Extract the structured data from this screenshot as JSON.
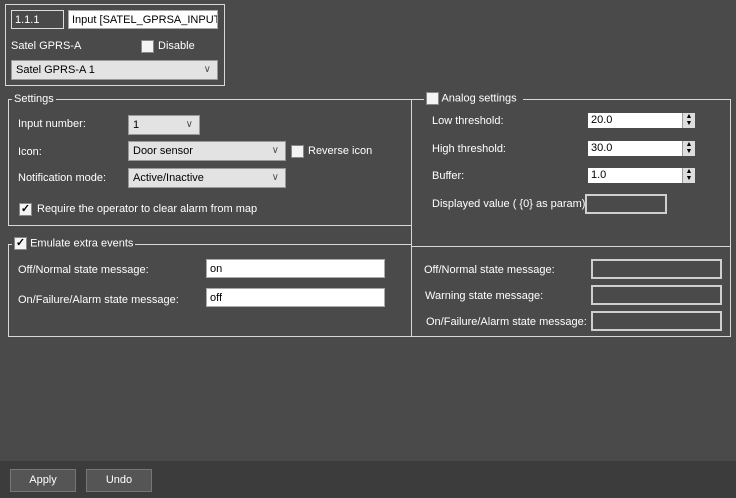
{
  "header": {
    "id": "1.1.1",
    "name": "Input [SATEL_GPRSA_INPUT",
    "device_label": "Satel GPRS-A",
    "disable_label": "Disable",
    "disable_checked": false,
    "device_select": "Satel GPRS-A 1"
  },
  "settings": {
    "legend": "Settings",
    "input_number_label": "Input number:",
    "input_number": "1",
    "icon_label": "Icon:",
    "icon": "Door sensor",
    "reverse_icon_label": "Reverse icon",
    "reverse_icon_checked": false,
    "notification_label": "Notification mode:",
    "notification": "Active/Inactive",
    "require_clear_label": "Require the operator to clear alarm from map",
    "require_clear_checked": true
  },
  "analog": {
    "legend": "Analog settings",
    "checked": false,
    "low_label": "Low threshold:",
    "low": "20.0",
    "high_label": "High threshold:",
    "high": "30.0",
    "buffer_label": "Buffer:",
    "buffer": "1.0",
    "displayed_label": "Displayed value ( {0} as param):",
    "displayed": ""
  },
  "emulate": {
    "legend": "Emulate extra events",
    "checked": true,
    "off_label": "Off/Normal state message:",
    "off": "on",
    "on_label": "On/Failure/Alarm state message:",
    "on": "off"
  },
  "analog_msgs": {
    "off_label": "Off/Normal state message:",
    "warning_label": "Warning state message:",
    "on_label": "On/Failure/Alarm state message:"
  },
  "footer": {
    "apply": "Apply",
    "undo": "Undo"
  }
}
